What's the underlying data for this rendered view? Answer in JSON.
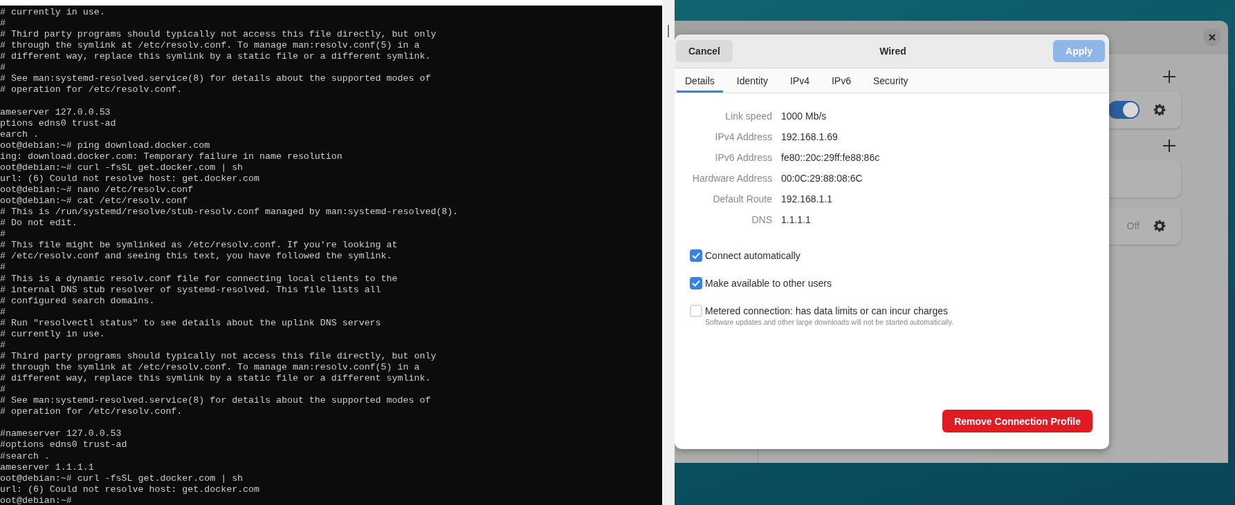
{
  "terminal": {
    "blocks": [
      [
        "# currently in use.",
        "#",
        "# Third party programs should typically not access this file directly, but only",
        "# through the symlink at /etc/resolv.conf. To manage man:resolv.conf(5) in a",
        "# different way, replace this symlink by a static file or a different symlink.",
        "#",
        "# See man:systemd-resolved.service(8) for details about the supported modes of",
        "# operation for /etc/resolv.conf."
      ],
      [
        "ameserver 127.0.0.53",
        "ptions edns0 trust-ad",
        "earch .",
        "oot@debian:~# ping download.docker.com",
        "ing: download.docker.com: Temporary failure in name resolution",
        "oot@debian:~# curl -fsSL get.docker.com | sh",
        "url: (6) Could not resolve host: get.docker.com",
        "oot@debian:~# nano /etc/resolv.conf",
        "oot@debian:~# cat /etc/resolv.conf",
        "# This is /run/systemd/resolve/stub-resolv.conf managed by man:systemd-resolved(8).",
        "# Do not edit.",
        "#",
        "# This file might be symlinked as /etc/resolv.conf. If you're looking at",
        "# /etc/resolv.conf and seeing this text, you have followed the symlink.",
        "#",
        "# This is a dynamic resolv.conf file for connecting local clients to the",
        "# internal DNS stub resolver of systemd-resolved. This file lists all",
        "# configured search domains.",
        "#",
        "# Run \"resolvectl status\" to see details about the uplink DNS servers",
        "# currently in use.",
        "#",
        "# Third party programs should typically not access this file directly, but only",
        "# through the symlink at /etc/resolv.conf. To manage man:resolv.conf(5) in a",
        "# different way, replace this symlink by a static file or a different symlink.",
        "#",
        "# See man:systemd-resolved.service(8) for details about the supported modes of",
        "# operation for /etc/resolv.conf."
      ],
      [
        "#nameserver 127.0.0.53",
        "#options edns0 trust-ad",
        "#search .",
        "ameserver 1.1.1.1",
        "oot@debian:~# curl -fsSL get.docker.com | sh",
        "url: (6) Could not resolve host: get.docker.com",
        "oot@debian:~#"
      ]
    ]
  },
  "settings_window": {
    "sections": [
      {
        "addable": true,
        "rows": [
          {
            "kind": "toggle",
            "on": true
          }
        ]
      },
      {
        "addable": true,
        "rows": [
          {
            "kind": "blank"
          }
        ]
      },
      {
        "addable": false,
        "rows": [
          {
            "kind": "status",
            "status": "Off"
          }
        ]
      }
    ]
  },
  "dialog": {
    "title": "Wired",
    "cancel": "Cancel",
    "apply": {
      "label": "Apply",
      "disabled": true
    },
    "tabs": [
      {
        "label": "Details",
        "selected": true
      },
      {
        "label": "Identity",
        "selected": false
      },
      {
        "label": "IPv4",
        "selected": false
      },
      {
        "label": "IPv6",
        "selected": false
      },
      {
        "label": "Security",
        "selected": false
      }
    ],
    "details": [
      {
        "label": "Link speed",
        "value": "1000 Mb/s"
      },
      {
        "label": "IPv4 Address",
        "value": "192.168.1.69"
      },
      {
        "label": "IPv6 Address",
        "value": "fe80::20c:29ff:fe88:86c"
      },
      {
        "label": "Hardware Address",
        "value": "00:0C:29:88:08:6C"
      },
      {
        "label": "Default Route",
        "value": "192.168.1.1"
      },
      {
        "label": "DNS",
        "value": "1.1.1.1"
      }
    ],
    "options": [
      {
        "label": "Connect automatically",
        "checked": true
      },
      {
        "label": "Make available to other users",
        "checked": true
      },
      {
        "label": "Metered connection: has data limits or can incur charges",
        "subtitle": "Software updates and other large downloads will not be started automatically.",
        "checked": false
      }
    ],
    "remove_button": "Remove Connection Profile"
  }
}
